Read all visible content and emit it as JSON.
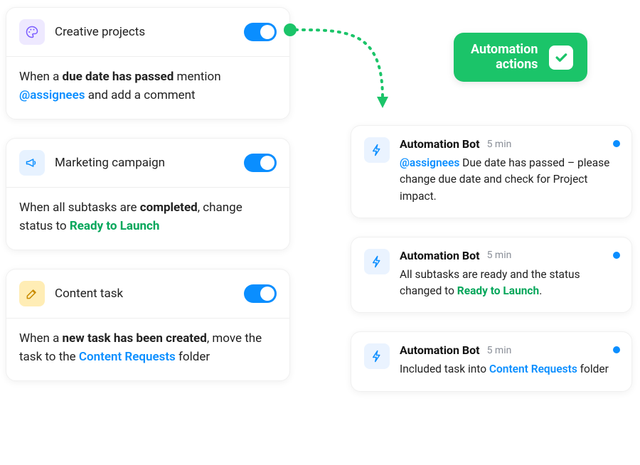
{
  "rules": [
    {
      "icon": "palette-icon",
      "title": "Creative projects",
      "enabled": true,
      "body": {
        "prefix": "When a ",
        "bold1": "due date has passed",
        "mid": " mention ",
        "mention": "@assignees",
        "suffix": " and add a comment"
      }
    },
    {
      "icon": "megaphone-icon",
      "title": "Marketing campaign",
      "enabled": true,
      "body": {
        "prefix": "When all subtasks are ",
        "bold1": "completed",
        "mid": ", change status to ",
        "status": "Ready to Launch",
        "suffix": ""
      }
    },
    {
      "icon": "pencil-square-icon",
      "title": "Content task",
      "enabled": true,
      "body": {
        "prefix": "When a ",
        "bold1": "new task has been created",
        "mid": ", move the task to the ",
        "link": "Content Requests",
        "suffix": " folder"
      }
    }
  ],
  "actions_chip": {
    "line1": "Automation",
    "line2": "actions"
  },
  "bot_name": "Automation Bot",
  "bot_time": "5 min",
  "notifications": [
    {
      "mention": "@assignees",
      "text": " Due date has passed – please change due date and check for Project impact."
    },
    {
      "text_before": "All subtasks are ready and the status changed to ",
      "status": "Ready to Launch",
      "text_after": "."
    },
    {
      "text_before": "Included task into ",
      "link": "Content Requests",
      "text_after": " folder"
    }
  ],
  "colors": {
    "blue": "#0a8eff",
    "green": "#1bc469",
    "status_green": "#04a65a"
  }
}
